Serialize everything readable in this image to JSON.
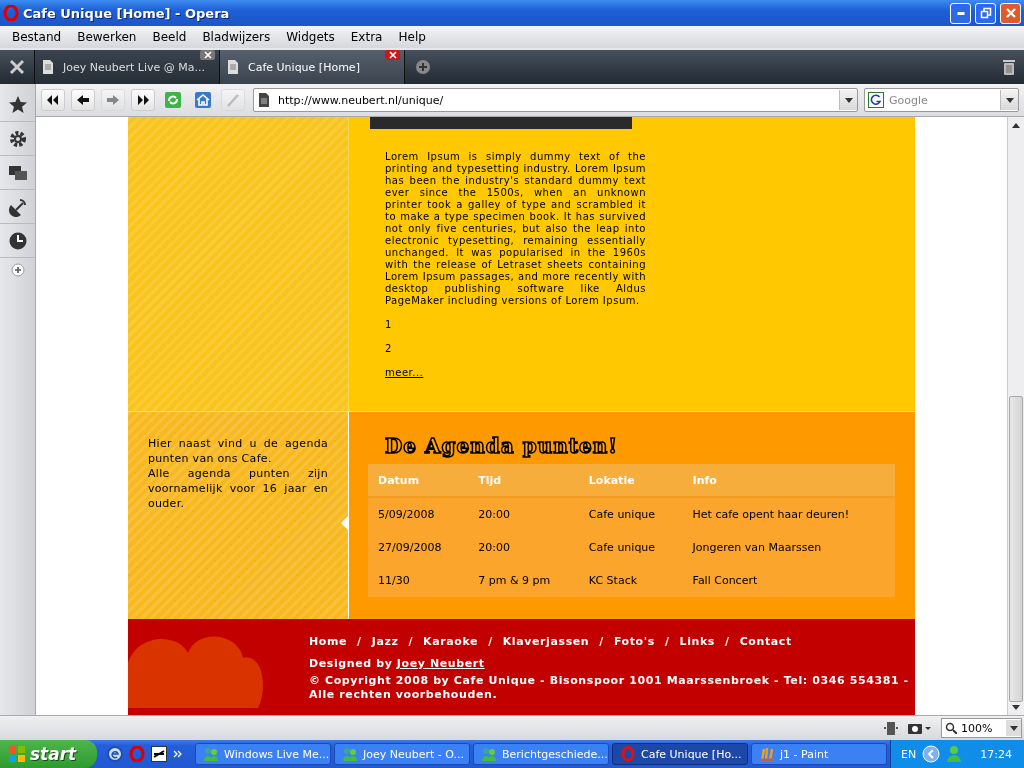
{
  "window": {
    "title": "Cafe Unique [Home] - Opera"
  },
  "menu": [
    "Bestand",
    "Bewerken",
    "Beeld",
    "Bladwijzers",
    "Widgets",
    "Extra",
    "Help"
  ],
  "tabs": [
    {
      "label": "Joey Neubert Live @ Ma...",
      "selected": false
    },
    {
      "label": "Cafe Unique [Home]",
      "selected": true
    }
  ],
  "toolbar": {
    "buttons": [
      {
        "kind": "rewind",
        "disabled": false
      },
      {
        "kind": "back",
        "disabled": false
      },
      {
        "kind": "forward",
        "disabled": true
      },
      {
        "kind": "fastforward",
        "disabled": false
      },
      {
        "kind": "reload",
        "disabled": false
      },
      {
        "kind": "home",
        "disabled": false
      },
      {
        "kind": "wand",
        "disabled": true
      }
    ],
    "url": "http://www.neubert.nl/unique/",
    "search_placeholder": "Google"
  },
  "page": {
    "article": {
      "paragraph": "Lorem Ipsum is simply dummy text of the printing and typesetting industry. Lorem Ipsum has been the industry's standard dummy text ever since the 1500s, when an unknown printer took a galley of type and scrambled it to make a type specimen book. It has survived not only five centuries, but also the leap into electronic typesetting, remaining essentially unchanged. It was popularised in the 1960s with the release of Letraset sheets containing Lorem Ipsum passages, and more recently with desktop publishing software like Aldus PageMaker including versions of Lorem Ipsum.",
      "items": [
        "1",
        "2"
      ],
      "more_link": "meer..."
    },
    "agenda_intro": [
      "Hier naast vind u de agenda punten van ons Cafe.",
      "Alle agenda punten zijn voornamelijk voor 16 jaar en ouder."
    ],
    "agenda": {
      "heading": "De Agenda punten!",
      "columns": [
        "Datum",
        "Tijd",
        "Lokatie",
        "Info"
      ],
      "rows": [
        [
          "5/09/2008",
          "20:00",
          "Cafe unique",
          "Het cafe opent haar deuren!"
        ],
        [
          "27/09/2008",
          "20:00",
          "Cafe unique",
          "Jongeren van Maarssen"
        ],
        [
          "11/30",
          "7 pm & 9 pm",
          "KC Stack",
          "Fall Concert"
        ]
      ]
    },
    "footer": {
      "nav": [
        {
          "kind": "link",
          "label": "Home"
        },
        {
          "kind": "separator",
          "label": "/"
        },
        {
          "kind": "link",
          "label": "Jazz"
        },
        {
          "kind": "separator",
          "label": "/"
        },
        {
          "kind": "link",
          "label": "Karaoke"
        },
        {
          "kind": "separator",
          "label": "/"
        },
        {
          "kind": "link",
          "label": "Klaverjassen"
        },
        {
          "kind": "separator",
          "label": "/"
        },
        {
          "kind": "link",
          "label": "Foto's"
        },
        {
          "kind": "separator",
          "label": "/"
        },
        {
          "kind": "link",
          "label": "Links"
        },
        {
          "kind": "separator",
          "label": "/"
        },
        {
          "kind": "link",
          "label": "Contact"
        }
      ],
      "designed_by": "Designed by",
      "designer_link": "Joey Neubert",
      "copyright": "© Copyright 2008 by Cafe Unique - Bisonspoor 1001 Maarssenbroek - Tel: 0346 554381 - Alle rechten voorbehouden."
    }
  },
  "status_bar": {
    "zoom": "100%"
  },
  "taskbar": {
    "start": "start",
    "tasks": [
      {
        "label": "Windows Live Me...",
        "kind": "messenger",
        "selected": false
      },
      {
        "label": "Joey Neubert - O...",
        "kind": "messenger",
        "selected": false
      },
      {
        "label": "Berichtgeschiede...",
        "kind": "messenger",
        "selected": false
      },
      {
        "label": "Cafe Unique [Ho...",
        "kind": "opera",
        "selected": true
      },
      {
        "label": "j1 - Paint",
        "kind": "paint",
        "selected": false
      }
    ],
    "language": "EN",
    "clock": "17:24"
  }
}
